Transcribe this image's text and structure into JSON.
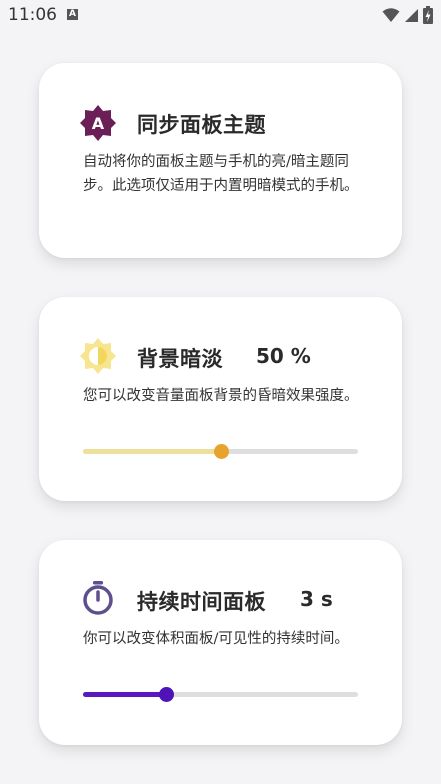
{
  "status_bar": {
    "time": "11:06",
    "notification_letter": "A",
    "icons": [
      "wifi-icon",
      "signal-icon",
      "battery-charging-icon"
    ]
  },
  "cards": [
    {
      "icon": "theme-badge-icon",
      "icon_letter": "A",
      "title": "同步面板主题",
      "description": "自动将你的面板主题与手机的亮/暗主题同步。此选项仅适用于内置明暗模式的手机。"
    },
    {
      "icon": "brightness-dim-icon",
      "title": "背景暗淡",
      "value": "50 %",
      "description": "您可以改变音量面板背景的昏暗效果强度。",
      "slider": {
        "fraction": 0.5,
        "fill_color": "#ede09a",
        "thumb_color": "#e8a32c"
      }
    },
    {
      "icon": "timer-icon",
      "title": "持续时间面板",
      "value": "3 s",
      "description": "你可以改变体积面板/可见性的持续时间。",
      "slider": {
        "fraction": 0.3,
        "fill_color": "#5a18c0",
        "thumb_color": "#4f14b8"
      }
    }
  ]
}
